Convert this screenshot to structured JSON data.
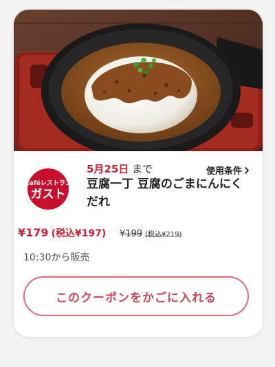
{
  "coupon": {
    "date_highlight": "5月25日",
    "date_suffix": " まで",
    "terms_label": "使用条件",
    "title": "豆腐一丁 豆腐のごまにんにくだれ",
    "price": "¥179",
    "price_tax": "(税込¥197)",
    "old_price": "¥199",
    "old_price_tax": "(税込¥219)",
    "hours": "10:30から販売",
    "add_to_cart_label": "このクーポンをかごに入れる"
  },
  "brand": {
    "logo_top": "Caféレストラン",
    "logo_main": "ガスト"
  },
  "colors": {
    "accent": "#c92236",
    "button_border": "#e06a7c",
    "logo_red": "#c8102e"
  }
}
